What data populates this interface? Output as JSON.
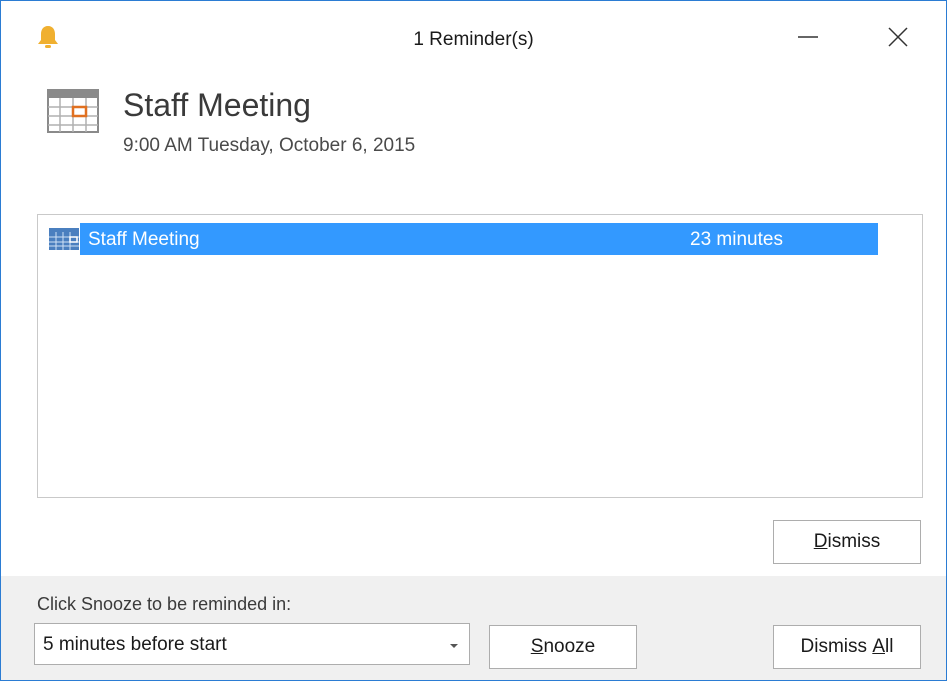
{
  "window": {
    "title": "1 Reminder(s)",
    "bell_icon": "bell-icon",
    "minimize_icon": "minimize-icon",
    "close_icon": "close-icon"
  },
  "header": {
    "icon": "calendar-icon",
    "title": "Staff Meeting",
    "subtitle": "9:00 AM Tuesday, October 6, 2015"
  },
  "reminders": [
    {
      "icon": "calendar-icon",
      "subject": "Staff Meeting",
      "due_in": "23 minutes",
      "selected": true
    }
  ],
  "actions": {
    "dismiss_label_mnemonic": "D",
    "dismiss_label_rest": "ismiss",
    "snooze_prompt": "Click Snooze to be reminded in:",
    "snooze_option": "5 minutes before start",
    "snooze_label_mnemonic": "S",
    "snooze_label_rest": "nooze",
    "dismiss_all_label_prefix": "Dismiss ",
    "dismiss_all_label_mnemonic": "A",
    "dismiss_all_label_rest": "ll"
  },
  "colors": {
    "selection": "#3399ff",
    "bell": "#f0b030",
    "window_border": "#2b7cd3",
    "bottom_panel": "#f0f0f0"
  }
}
